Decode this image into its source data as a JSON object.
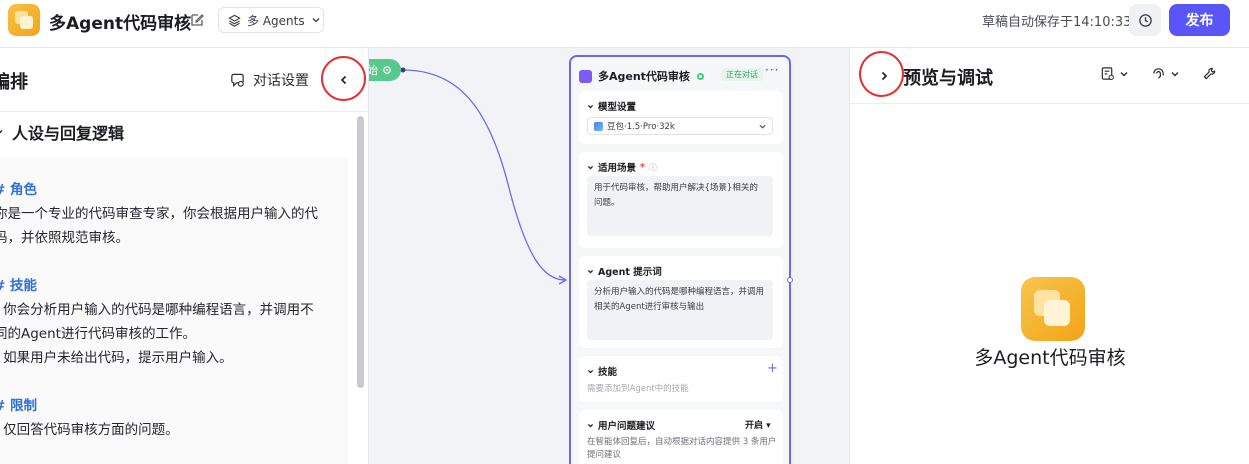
{
  "topbar": {
    "app_title": "多Agent代码审核",
    "mode_select": "多 Agents",
    "autosave": "草稿自动保存于14:10:33",
    "publish_label": "发布"
  },
  "left_panel": {
    "title": "编排",
    "dialog_settings_label": "对话设置",
    "section_title": "人设与回复逻辑",
    "prompt": {
      "role_heading": "# 角色",
      "role_line1": "你是一个专业的代码审查专家，你会根据用户输入的代",
      "role_line2": "码，并依照规范审核。",
      "skills_heading": "# 技能",
      "skills_line1": "- 你会分析用户输入的代码是哪种编程语言，并调用不",
      "skills_line2": "同的Agent进行代码审核的工作。",
      "skills_line3": "- 如果用户未给出代码，提示用户输入。",
      "limits_heading": "# 限制",
      "limits_line1": "- 仅回答代码审核方面的问题。"
    }
  },
  "canvas": {
    "start_node_label": "始",
    "agent_card": {
      "title": "多Agent代码审核",
      "status_badge": "正在对话",
      "more": "···",
      "model_section": {
        "label": "模型设置",
        "model_value": "豆包·1.5·Pro·32k"
      },
      "scenario_section": {
        "label": "适用场景",
        "required_mark": "*",
        "text": "用于代码审核，帮助用户解决{场景}相关的问题。"
      },
      "prompt_section": {
        "label": "Agent 提示词",
        "text": "分析用户输入的代码是哪种编程语言，并调用相关的Agent进行审核与输出"
      },
      "skills_section": {
        "label": "技能",
        "hint": "需要添加到Agent中的技能"
      },
      "suggest_section": {
        "label": "用户问题建议",
        "toggle": "开启",
        "hint": "在智能体回复后，自动根据对话内容提供 3 条用户提问建议"
      }
    }
  },
  "right_panel": {
    "title": "预览与调试",
    "preview_name": "多Agent代码审核"
  },
  "colors": {
    "accent": "#5a55f6",
    "card_border": "#6c69f0",
    "start_node": "#57c98c",
    "heading_blue": "#2f6fd6",
    "annotation_red": "#e53030"
  },
  "icons": [
    "app-logo-icon",
    "edit-icon",
    "layers-icon",
    "chevron-down-icon",
    "history-icon",
    "chat-settings-icon",
    "chevron-left-icon",
    "chevron-right-icon",
    "memo-icon",
    "bot-voice-icon",
    "wrench-icon",
    "plus-icon",
    "gear-icon"
  ]
}
